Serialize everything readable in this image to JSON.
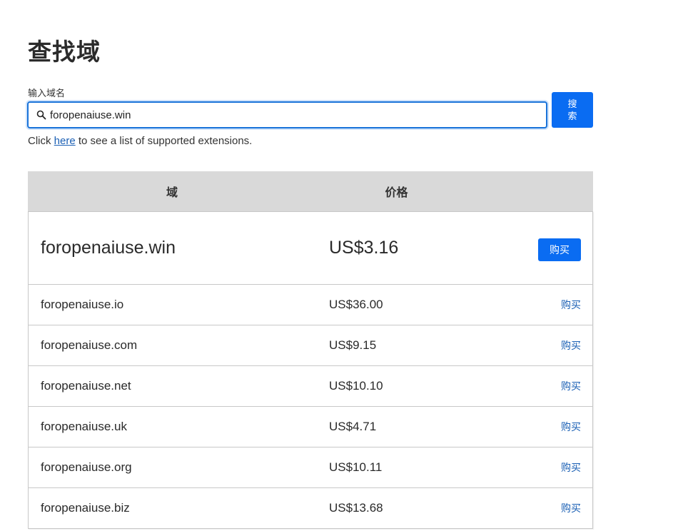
{
  "page": {
    "title": "查找域"
  },
  "search": {
    "label": "输入域名",
    "value": "foropenaiuse.win",
    "button_label": "搜索"
  },
  "hint": {
    "prefix": "Click ",
    "link": "here",
    "suffix": " to see a list of supported extensions."
  },
  "table": {
    "headers": {
      "domain": "域",
      "price": "价格"
    },
    "featured": {
      "domain": "foropenaiuse.win",
      "price": "US$3.16",
      "buy": "购买"
    },
    "rows": [
      {
        "domain": "foropenaiuse.io",
        "price": "US$36.00",
        "buy": "购买"
      },
      {
        "domain": "foropenaiuse.com",
        "price": "US$9.15",
        "buy": "购买"
      },
      {
        "domain": "foropenaiuse.net",
        "price": "US$10.10",
        "buy": "购买"
      },
      {
        "domain": "foropenaiuse.uk",
        "price": "US$4.71",
        "buy": "购买"
      },
      {
        "domain": "foropenaiuse.org",
        "price": "US$10.11",
        "buy": "购买"
      },
      {
        "domain": "foropenaiuse.biz",
        "price": "US$13.68",
        "buy": "购买"
      }
    ]
  },
  "colors": {
    "accent": "#0a6cf2",
    "link": "#1a5fb4",
    "header_bg": "#d9d9d9"
  }
}
